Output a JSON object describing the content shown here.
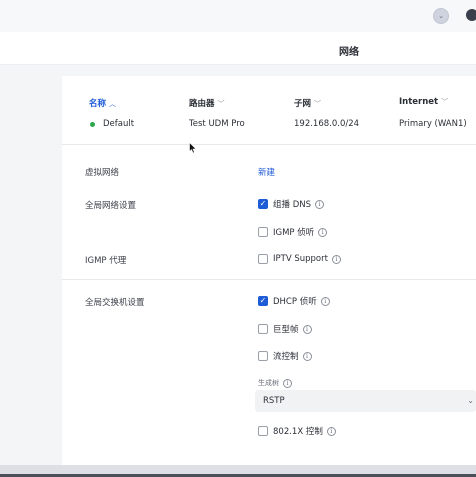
{
  "header": {
    "title": "网络"
  },
  "table": {
    "columns": [
      {
        "label": "名称",
        "sort": "up"
      },
      {
        "label": "路由器",
        "sort": "down"
      },
      {
        "label": "子网",
        "sort": "down"
      },
      {
        "label": "Internet",
        "sort": "down"
      }
    ],
    "rows": [
      {
        "status": "online",
        "name": "Default",
        "router": "Test UDM Pro",
        "subnet": "192.168.0.0/24",
        "internet": "Primary (WAN1)"
      }
    ]
  },
  "settings": {
    "virtual_network": {
      "label": "虚拟网络",
      "action": "新建"
    },
    "global_network": {
      "label": "全局网络设置",
      "options": [
        {
          "label": "组播 DNS",
          "checked": true
        },
        {
          "label": "IGMP 侦听",
          "checked": false
        }
      ]
    },
    "igmp_proxy": {
      "label": "IGMP 代理",
      "options": [
        {
          "label": "IPTV Support",
          "checked": false
        }
      ]
    },
    "global_switch": {
      "label": "全局交换机设置",
      "options": [
        {
          "label": "DHCP 侦听",
          "checked": true
        },
        {
          "label": "巨型帧",
          "checked": false
        },
        {
          "label": "流控制",
          "checked": false
        }
      ],
      "spanning_tree": {
        "label": "生成树",
        "value": "RSTP"
      },
      "dot1x": {
        "label": "802.1X 控制",
        "checked": false
      }
    }
  },
  "colors": {
    "accent": "#1e5bd7",
    "status_online": "#2aa84a"
  },
  "icons": {
    "info": "info-icon",
    "sort_up": "chevron-up-icon",
    "sort_down": "chevron-down-icon",
    "select": "chevron-down-icon"
  }
}
